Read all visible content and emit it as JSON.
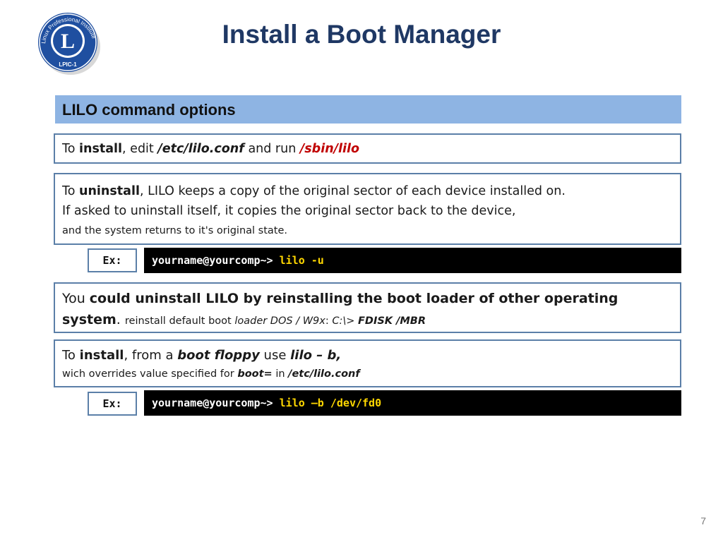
{
  "logo": {
    "ring_text": "Linux Professional Institute",
    "center_text": "L",
    "badge_text": "LPIC-1",
    "colors": {
      "ring": "#1f4fa0",
      "center": "#ffffff"
    }
  },
  "title": "Install a Boot Manager",
  "section_header": "LILO command options",
  "box_install": {
    "t1": "To ",
    "t2": "install",
    "t3": ", edit ",
    "t4": "/etc/lilo.conf",
    "t5": " and run ",
    "t6": "/sbin/lilo"
  },
  "box_uninstall": {
    "t1": "To ",
    "t2": "uninstall",
    "t3": ", LILO keeps a copy of the original sector of each device installed on.",
    "line2": "If asked to uninstall itself, it copies the original sector back to the device,",
    "line3": "and the system returns to it's original state."
  },
  "example1": {
    "label": "Ex:",
    "prompt": "yourname@yourcomp~> ",
    "command": "lilo -u"
  },
  "box_reinstall": {
    "t1": "You ",
    "t2": "could uninstall LILO by reinstalling the boot loader of other operating",
    "t3": "system",
    "t4": ". ",
    "t5": "reinstall default boot ",
    "t6": "loader DOS / W9x",
    "t7": ": ",
    "t8": "C:\\> ",
    "t9": "FDISK /MBR"
  },
  "box_floppy": {
    "t1": "To ",
    "t2": "install",
    "t3": ", from a ",
    "t4": "boot floppy",
    "t5": " use ",
    "t6": "lilo – b,",
    "line2_1": "wich overrides value specified for ",
    "line2_2": "boot=",
    "line2_3": " in ",
    "line2_4": "/etc/lilo.conf"
  },
  "example2": {
    "label": "Ex:",
    "prompt": "yourname@yourcomp~> ",
    "command": "lilo –b /dev/fd0"
  },
  "page_number": "7",
  "colors": {
    "title": "#1f3864",
    "header_bar": "#8eb4e3",
    "box_border": "#5b7fa8",
    "highlight_red": "#c00000",
    "command_text": "#ffd700",
    "terminal_bg": "#000000"
  }
}
